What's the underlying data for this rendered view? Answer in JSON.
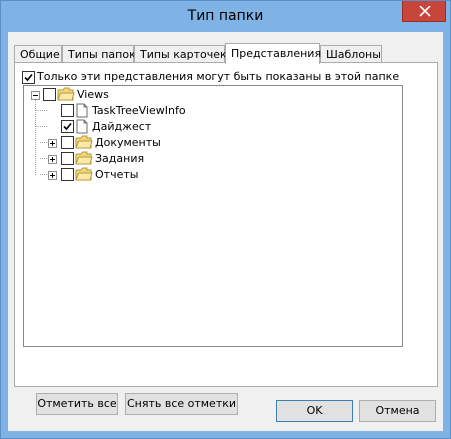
{
  "window": {
    "title": "Тип папки"
  },
  "tabs": [
    {
      "label": "Общие",
      "active": false
    },
    {
      "label": "Типы папок",
      "active": false
    },
    {
      "label": "Типы карточек",
      "active": false
    },
    {
      "label": "Представления",
      "active": true
    },
    {
      "label": "Шаблоны",
      "active": false
    }
  ],
  "panel": {
    "only_these_label": "Только эти представления могут быть показаны в этой папке",
    "only_these_checked": true
  },
  "tree": {
    "root": {
      "label": "Views",
      "expanded": true,
      "checked": false,
      "icon": "folder-icon"
    },
    "children": [
      {
        "label": "TaskTreeViewInfo",
        "checked": false,
        "icon": "document-icon",
        "expandable": false
      },
      {
        "label": "Дайджест",
        "checked": true,
        "icon": "document-icon",
        "expandable": false
      },
      {
        "label": "Документы",
        "checked": false,
        "icon": "folder-icon",
        "expandable": true
      },
      {
        "label": "Задания",
        "checked": false,
        "icon": "folder-icon",
        "expandable": true
      },
      {
        "label": "Отчеты",
        "checked": false,
        "icon": "folder-icon",
        "expandable": true
      }
    ]
  },
  "buttons": {
    "check_all": "Отметить все",
    "uncheck_all": "Снять все отметки",
    "ok": "OK",
    "cancel": "Отмена"
  },
  "colors": {
    "titlebar": "#7fb2e5",
    "close": "#c7453a",
    "folder": "#f5d77a"
  }
}
